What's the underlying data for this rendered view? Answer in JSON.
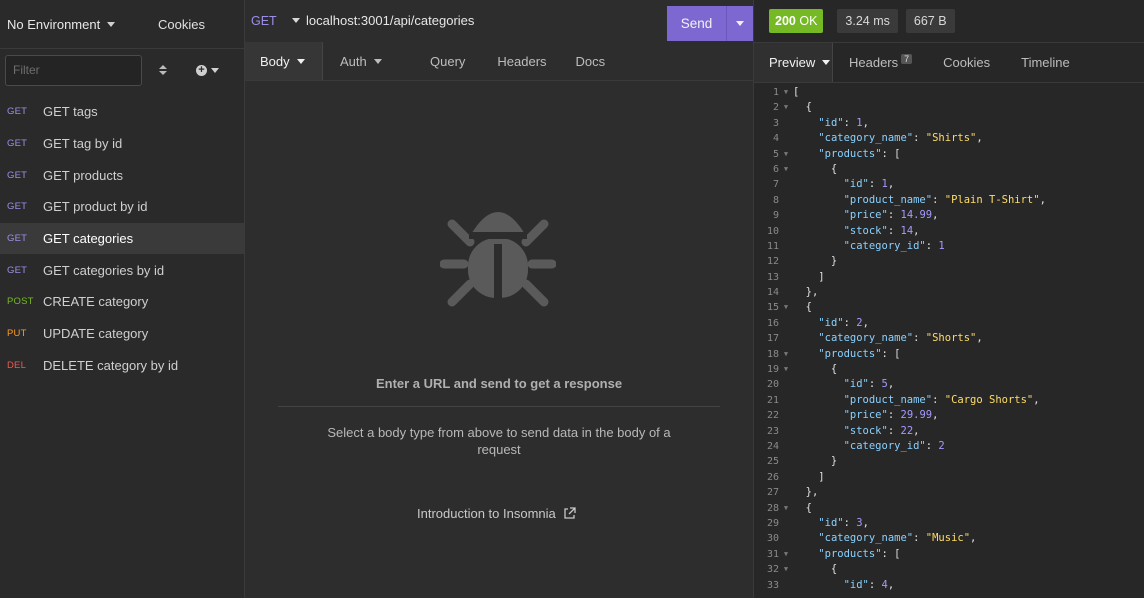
{
  "sidebar": {
    "environment": "No Environment",
    "cookies_label": "Cookies",
    "filter_placeholder": "Filter",
    "requests": [
      {
        "method": "GET",
        "name": "GET tags",
        "cls": "m-get"
      },
      {
        "method": "GET",
        "name": "GET tag by id",
        "cls": "m-get"
      },
      {
        "method": "GET",
        "name": "GET products",
        "cls": "m-get"
      },
      {
        "method": "GET",
        "name": "GET product by id",
        "cls": "m-get"
      },
      {
        "method": "GET",
        "name": "GET categories",
        "cls": "m-get",
        "active": true
      },
      {
        "method": "GET",
        "name": "GET categories by id",
        "cls": "m-get"
      },
      {
        "method": "POST",
        "name": "CREATE category",
        "cls": "m-post"
      },
      {
        "method": "PUT",
        "name": "UPDATE category",
        "cls": "m-put"
      },
      {
        "method": "DEL",
        "name": "DELETE category by id",
        "cls": "m-del"
      }
    ]
  },
  "request": {
    "method": "GET",
    "url": "localhost:3001/api/categories",
    "send_label": "Send",
    "tabs": [
      "Body",
      "Auth",
      "Query",
      "Headers",
      "Docs"
    ],
    "empty_title": "Enter a URL and send to get a response",
    "empty_sub": "Select a body type from above to send data in the body of a request",
    "intro_link": "Introduction to Insomnia"
  },
  "response": {
    "status_code": "200",
    "status_text": "OK",
    "time": "3.24 ms",
    "size": "667 B",
    "tabs": {
      "preview": "Preview",
      "headers": "Headers",
      "headers_count": "7",
      "cookies": "Cookies",
      "timeline": "Timeline"
    },
    "lines": [
      "[",
      "  {",
      "    \"id\": 1,",
      "    \"category_name\": \"Shirts\",",
      "    \"products\": [",
      "      {",
      "        \"id\": 1,",
      "        \"product_name\": \"Plain T-Shirt\",",
      "        \"price\": 14.99,",
      "        \"stock\": 14,",
      "        \"category_id\": 1",
      "      }",
      "    ]",
      "  },",
      "  {",
      "    \"id\": 2,",
      "    \"category_name\": \"Shorts\",",
      "    \"products\": [",
      "      {",
      "        \"id\": 5,",
      "        \"product_name\": \"Cargo Shorts\",",
      "        \"price\": 29.99,",
      "        \"stock\": 22,",
      "        \"category_id\": 2",
      "      }",
      "    ]",
      "  },",
      "  {",
      "    \"id\": 3,",
      "    \"category_name\": \"Music\",",
      "    \"products\": [",
      "      {",
      "        \"id\": 4,"
    ],
    "fold_lines": [
      1,
      2,
      5,
      6,
      15,
      18,
      19,
      28,
      31,
      32
    ]
  },
  "colors": {
    "accent": "#7c68d0",
    "status_ok": "#75ba24",
    "get": "#9b8fe8",
    "post": "#75ba24",
    "put": "#ff9a1f",
    "delete": "#ee5a4f"
  }
}
